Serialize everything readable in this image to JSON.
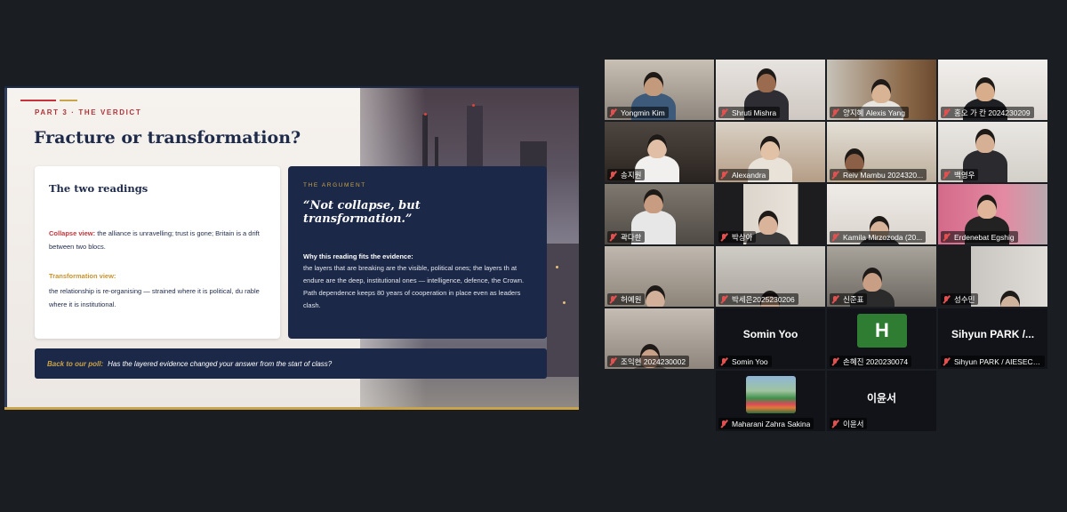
{
  "slide": {
    "eyebrow": "PART 3 · THE VERDICT",
    "title": "Fracture or transformation?",
    "left_card": {
      "heading": "The two readings",
      "collapse_label": "Collapse view:",
      "collapse_text": " the alliance is unravelling; trust is gone; Britain is a drift between two blocs.",
      "transform_label": "Transformation view:",
      "transform_text": "the relationship is re-organising — strained where it is political, du rable where it is institutional."
    },
    "right_card": {
      "eyebrow": "THE ARGUMENT",
      "quote": "“Not collapse, but transformation.”",
      "evidence_heading": "Why this reading fits the evidence:",
      "evidence_text": "the layers that are breaking are the visible, political ones; the layers th at endure are the deep, institutional ones — intelligence, defence, the Crown. Path dependence keeps 80 years of cooperation in place even as leaders clash."
    },
    "poll": {
      "label": "Back to our poll:",
      "question": "Has the layered evidence changed your answer from the start of class?"
    }
  },
  "participants": [
    {
      "name": "Yongmin Kim",
      "active": true,
      "video": true,
      "scheme": "a"
    },
    {
      "name": "Shruti Mishra",
      "video": true,
      "scheme": "b"
    },
    {
      "name": "양지혜 Alexis Yang",
      "video": true,
      "scheme": "c"
    },
    {
      "name": "홍오 가 칸 2024230209",
      "video": true,
      "scheme": "d"
    },
    {
      "name": "송지원",
      "video": true,
      "scheme": "e"
    },
    {
      "name": "Alexandra",
      "video": true,
      "scheme": "f"
    },
    {
      "name": "Reiv Mambu 2024320...",
      "video": true,
      "scheme": "g"
    },
    {
      "name": "백영우",
      "video": true,
      "scheme": "h"
    },
    {
      "name": "곽다한",
      "video": true,
      "scheme": "i"
    },
    {
      "name": "박상아",
      "video": true,
      "scheme": "j"
    },
    {
      "name": "Kamila Mirzozoda (20...",
      "video": true,
      "scheme": "k"
    },
    {
      "name": "Erdenebat Egshig",
      "video": true,
      "scheme": "l"
    },
    {
      "name": "허예원",
      "video": true,
      "scheme": "m"
    },
    {
      "name": "박세은2025230206",
      "video": true,
      "scheme": "n"
    },
    {
      "name": "신준표",
      "video": true,
      "scheme": "o"
    },
    {
      "name": "성수민",
      "video": true,
      "scheme": "p"
    },
    {
      "name": "조익현 2024230002",
      "video": true,
      "scheme": "q"
    },
    {
      "name": "Somin Yoo",
      "video": false,
      "display": "Somin Yoo"
    },
    {
      "name": "손혜진 2020230074",
      "video": false,
      "avatar_letter": "H"
    },
    {
      "name": "Sihyun PARK / AIESEC ...",
      "video": false,
      "display": "Sihyun PARK /..."
    },
    {
      "name": "Maharani Zahra Sakina",
      "video": false,
      "picture": true
    },
    {
      "name": "이윤서",
      "video": false,
      "display": "이윤서"
    }
  ],
  "colors": {
    "navy": "#1c2847",
    "accent_red": "#c8323a",
    "accent_gold": "#c9a44a",
    "active_speaker": "#3bc76b",
    "muted_mic": "#e35050"
  },
  "icons": {
    "muted": "muted-mic-icon"
  }
}
